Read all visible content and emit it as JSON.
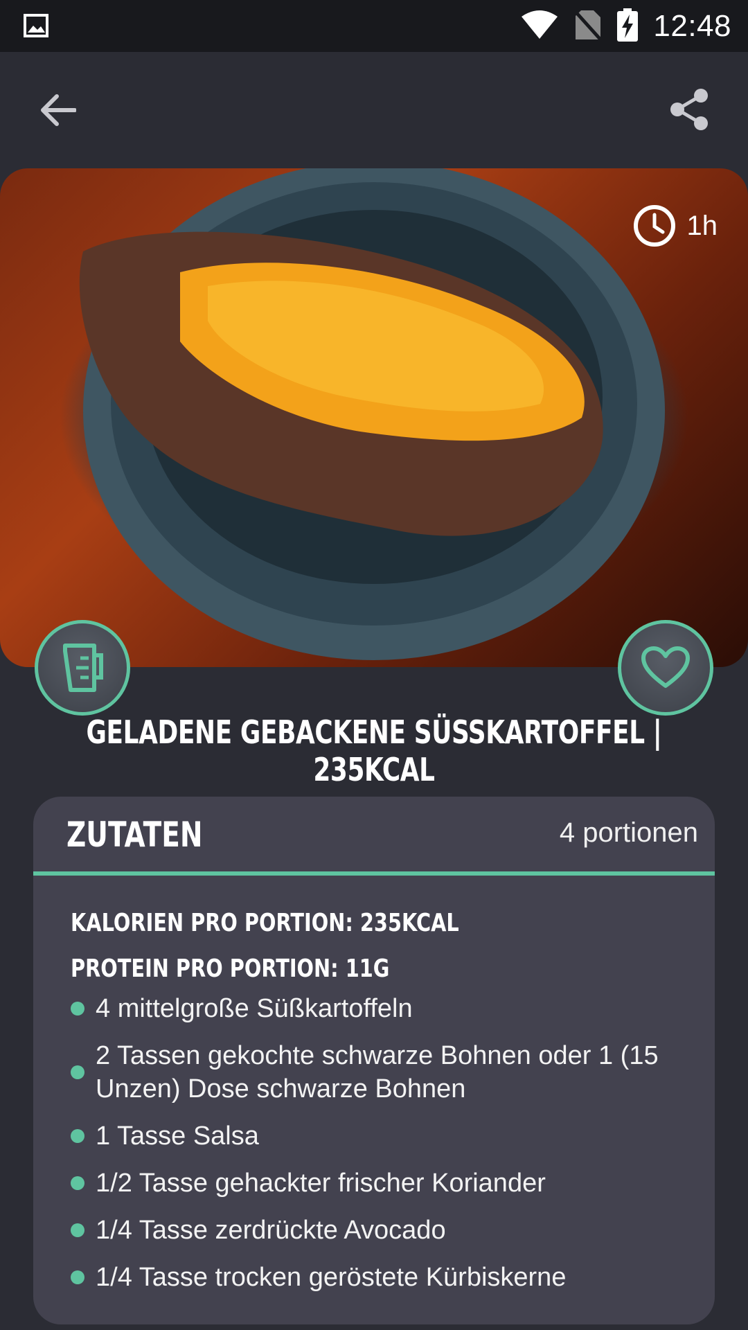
{
  "status_bar": {
    "time": "12:48",
    "icons": [
      "gallery-icon",
      "wifi-icon",
      "no-sim-icon",
      "battery-charging-icon"
    ]
  },
  "app_bar": {
    "back_icon": "arrow-left-icon",
    "share_icon": "share-icon"
  },
  "recipe": {
    "prep_time": "1h",
    "title": "GELADENE GEBACKENE SÜSSKARTOFFEL | 235KCAL",
    "fab_left_icon": "measuring-cup-icon",
    "fab_right_icon": "heart-icon"
  },
  "ingredients": {
    "heading": "ZUTATEN",
    "servings": "4 portionen",
    "calories": "KALORIEN PRO PORTION: 235KCAL",
    "protein": "PROTEIN PRO PORTION: 11G",
    "items": [
      "4 mittelgroße Süßkartoffeln",
      "2 Tassen gekochte schwarze Bohnen oder 1 (15 Unzen) Dose schwarze Bohnen",
      "1 Tasse Salsa",
      "1/2 Tasse gehackter frischer Koriander",
      "1/4 Tasse zerdrückte Avocado",
      "1/4 Tasse trocken geröstete Kürbiskerne"
    ]
  },
  "colors": {
    "accent": "#5fc4a0",
    "background": "#2b2c34",
    "card": "#43424f"
  }
}
